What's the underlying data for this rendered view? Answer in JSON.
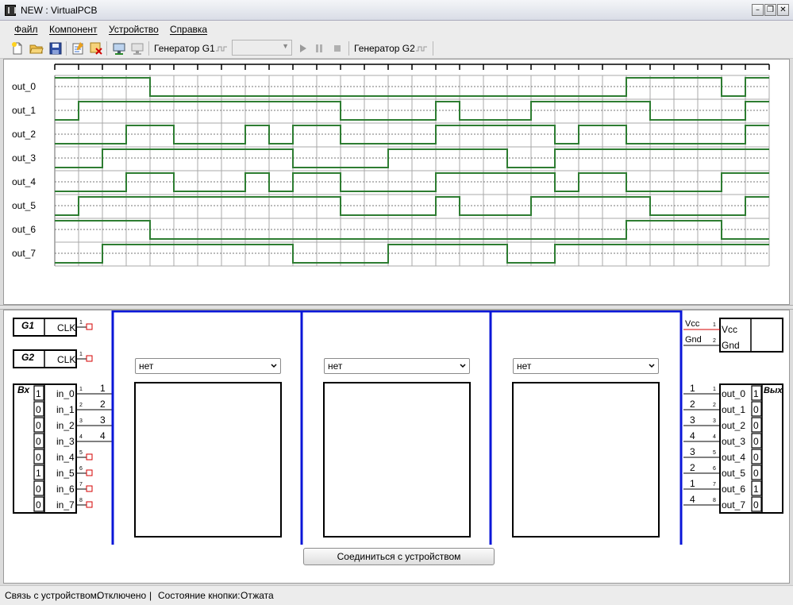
{
  "window": {
    "title": "NEW : VirtualPCB"
  },
  "menu": {
    "items": [
      "Файл",
      "Компонент",
      "Устройство",
      "Справка"
    ]
  },
  "toolbar": {
    "gen1_label": "Генератор G1",
    "gen2_label": "Генератор G2"
  },
  "waveforms": {
    "signals": [
      {
        "name": "out_0",
        "levels": [
          1,
          1,
          1,
          1,
          0,
          0,
          0,
          0,
          0,
          0,
          0,
          0,
          0,
          0,
          0,
          0,
          0,
          0,
          0,
          0,
          0,
          0,
          0,
          0,
          1,
          1,
          1,
          1,
          0,
          1
        ]
      },
      {
        "name": "out_1",
        "levels": [
          0,
          1,
          1,
          1,
          1,
          1,
          1,
          1,
          1,
          1,
          1,
          1,
          0,
          0,
          0,
          0,
          1,
          0,
          0,
          0,
          1,
          1,
          1,
          1,
          1,
          0,
          0,
          0,
          0,
          1
        ]
      },
      {
        "name": "out_2",
        "levels": [
          0,
          0,
          0,
          1,
          1,
          0,
          0,
          0,
          1,
          0,
          1,
          1,
          0,
          0,
          0,
          0,
          1,
          1,
          1,
          1,
          1,
          0,
          1,
          1,
          0,
          0,
          0,
          0,
          0,
          1
        ]
      },
      {
        "name": "out_3",
        "levels": [
          0,
          0,
          1,
          1,
          1,
          1,
          1,
          1,
          1,
          1,
          0,
          0,
          0,
          0,
          1,
          1,
          1,
          1,
          1,
          0,
          0,
          1,
          1,
          1,
          1,
          1,
          1,
          1,
          1,
          1
        ]
      },
      {
        "name": "out_4",
        "levels": [
          0,
          0,
          0,
          1,
          1,
          0,
          0,
          0,
          1,
          0,
          1,
          1,
          0,
          0,
          0,
          0,
          1,
          1,
          1,
          1,
          1,
          0,
          1,
          1,
          0,
          0,
          0,
          0,
          1,
          1
        ]
      },
      {
        "name": "out_5",
        "levels": [
          0,
          1,
          1,
          1,
          1,
          1,
          1,
          1,
          1,
          1,
          1,
          1,
          0,
          0,
          0,
          0,
          1,
          0,
          0,
          0,
          1,
          1,
          1,
          1,
          1,
          0,
          0,
          0,
          0,
          1
        ]
      },
      {
        "name": "out_6",
        "levels": [
          1,
          1,
          1,
          1,
          0,
          0,
          0,
          0,
          0,
          0,
          0,
          0,
          0,
          0,
          0,
          0,
          0,
          0,
          0,
          0,
          0,
          0,
          0,
          0,
          1,
          1,
          1,
          1,
          0,
          0
        ]
      },
      {
        "name": "out_7",
        "levels": [
          0,
          0,
          1,
          1,
          1,
          1,
          1,
          1,
          1,
          1,
          0,
          0,
          0,
          0,
          1,
          1,
          1,
          1,
          1,
          0,
          0,
          1,
          1,
          1,
          1,
          1,
          1,
          1,
          1,
          1
        ]
      }
    ]
  },
  "board": {
    "g1": {
      "title": "G1",
      "pin_label": "CLK",
      "pin_num": "1"
    },
    "g2": {
      "title": "G2",
      "pin_label": "CLK",
      "pin_num": "1"
    },
    "inputs": {
      "title": "Вх",
      "pins": [
        {
          "label": "in_0",
          "value": "1",
          "num": "1",
          "wire": "1"
        },
        {
          "label": "in_1",
          "value": "0",
          "num": "2",
          "wire": "2"
        },
        {
          "label": "in_2",
          "value": "0",
          "num": "3",
          "wire": "3"
        },
        {
          "label": "in_3",
          "value": "0",
          "num": "4",
          "wire": "4"
        },
        {
          "label": "in_4",
          "value": "0",
          "num": "5",
          "wire": ""
        },
        {
          "label": "in_5",
          "value": "1",
          "num": "6",
          "wire": ""
        },
        {
          "label": "in_6",
          "value": "0",
          "num": "7",
          "wire": ""
        },
        {
          "label": "in_7",
          "value": "0",
          "num": "8",
          "wire": ""
        }
      ]
    },
    "power": {
      "pins": [
        {
          "wire": "Vcc",
          "num": "1",
          "label": "Vcc"
        },
        {
          "wire": "Gnd",
          "num": "2",
          "label": "Gnd"
        }
      ]
    },
    "outputs": {
      "title": "Вых",
      "pins": [
        {
          "label": "out_0",
          "value": "1",
          "num": "1",
          "wire": "1"
        },
        {
          "label": "out_1",
          "value": "0",
          "num": "2",
          "wire": "2"
        },
        {
          "label": "out_2",
          "value": "0",
          "num": "3",
          "wire": "3"
        },
        {
          "label": "out_3",
          "value": "0",
          "num": "4",
          "wire": "4"
        },
        {
          "label": "out_4",
          "value": "0",
          "num": "5",
          "wire": "3"
        },
        {
          "label": "out_5",
          "value": "0",
          "num": "6",
          "wire": "2"
        },
        {
          "label": "out_6",
          "value": "1",
          "num": "7",
          "wire": "1"
        },
        {
          "label": "out_7",
          "value": "0",
          "num": "8",
          "wire": "4"
        }
      ]
    },
    "slots": [
      {
        "selected": "нет"
      },
      {
        "selected": "нет"
      },
      {
        "selected": "нет"
      }
    ],
    "connect_button": "Соединиться с устройством"
  },
  "status": {
    "connection_label": "Связь с устройством:",
    "connection_value": "Отключено",
    "separator": "|",
    "button_label": "Состояние кнопки:",
    "button_value": "Отжата"
  },
  "colors": {
    "wave": "#2e7d32",
    "bus": "#0a16d8",
    "unconnected": "#d40000"
  }
}
